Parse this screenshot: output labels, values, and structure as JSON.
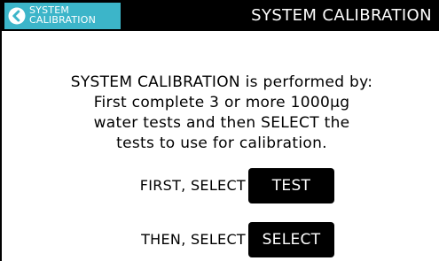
{
  "header": {
    "back_button_label": "SYSTEM\nCALIBRATION",
    "title": "SYSTEM CALIBRATION"
  },
  "instructions": {
    "text": "SYSTEM CALIBRATION is performed by:\nFirst complete 3 or more 1000µg\nwater tests and then SELECT the\ntests to use for calibration."
  },
  "steps": [
    {
      "label": "FIRST, SELECT",
      "button_label": "TEST"
    },
    {
      "label": "THEN, SELECT",
      "button_label": "SELECT"
    }
  ],
  "colors": {
    "header_background": "#000000",
    "back_button_background": "#3cb5c9",
    "page_background": "#ffffff",
    "button_background": "#000000",
    "button_text": "#ffffff"
  },
  "icons": {
    "back": "chevron-left-circle-icon"
  }
}
